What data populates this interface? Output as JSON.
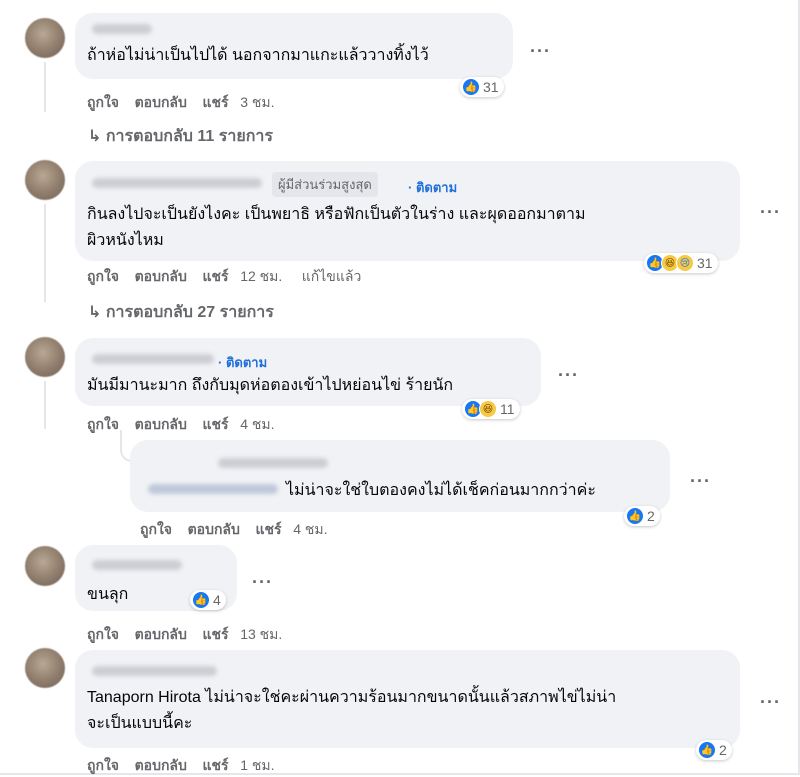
{
  "comments": [
    {
      "name": "",
      "text": "ถ้าห่อไม่น่าเป็นไปได้ นอกจากมาแกะแล้ววางทิ้งไว้",
      "actions": {
        "like": "ถูกใจ",
        "reply": "ตอบกลับ",
        "share": "แชร์",
        "time": "3 ชม."
      },
      "reaction_count": "31",
      "view_replies": "การตอบกลับ 11 รายการ"
    },
    {
      "role": "ผู้มีส่วนร่วมสูงสุด",
      "follow": "· ติดตาม",
      "text_line1": "กินลงไปจะเป็นยังไงคะ เป็นพยาธิ หรือฟักเป็นตัวในร่าง และผุดออกมาตาม",
      "text_line2": "ผิวหนังไหม",
      "actions": {
        "like": "ถูกใจ",
        "reply": "ตอบกลับ",
        "share": "แชร์",
        "time": "12 ชม.",
        "edited": "แก้ไขแล้ว"
      },
      "reaction_count": "31",
      "view_replies": "การตอบกลับ 27 รายการ"
    },
    {
      "follow": "· ติดตาม",
      "text": "มันมีมานะมาก ถึงกับมุดห่อตองเข้าไปหย่อนไข่ ร้ายนัก",
      "actions": {
        "like": "ถูกใจ",
        "reply": "ตอบกลับ",
        "share": "แชร์",
        "time": "4 ชม."
      },
      "reaction_count": "11"
    },
    {
      "text": "ไม่น่าจะใช่ใบตองคงไม่ได้เช็คก่อนมากกว่าค่ะ",
      "actions": {
        "like": "ถูกใจ",
        "reply": "ตอบกลับ",
        "share": "แชร์",
        "time": "4 ชม."
      },
      "reaction_count": "2"
    },
    {
      "text": "ขนลุก",
      "actions": {
        "like": "ถูกใจ",
        "reply": "ตอบกลับ",
        "share": "แชร์",
        "time": "13 ชม."
      },
      "reaction_count": "4"
    },
    {
      "text_line1": "Tanaporn Hirota ไม่น่าจะใช่คะผ่านความร้อนมากขนาดนั้นแล้วสภาพไข่ไม่น่า",
      "text_line2": "จะเป็นแบบนี้คะ",
      "actions": {
        "like": "ถูกใจ",
        "reply": "ตอบกลับ",
        "share": "แชร์",
        "time": "1 ชม."
      },
      "reaction_count": "2"
    }
  ],
  "ui": {
    "more_dots": "···",
    "reply_arrow": "↳",
    "like_icon": "like-icon",
    "haha_icon": "haha-icon",
    "sad_icon": "sad-icon"
  }
}
